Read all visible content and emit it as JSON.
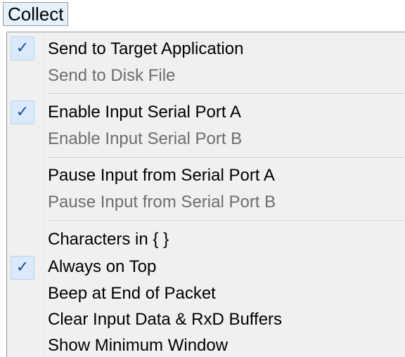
{
  "menu": {
    "title": "Collect",
    "items": [
      {
        "label": "Send to Target Application",
        "checked": true,
        "enabled": true
      },
      {
        "label": "Send to Disk File",
        "checked": false,
        "enabled": false
      },
      {
        "label": "Enable Input Serial Port A",
        "checked": true,
        "enabled": true
      },
      {
        "label": "Enable Input Serial Port B",
        "checked": false,
        "enabled": false
      },
      {
        "label": "Pause Input from Serial Port A",
        "checked": false,
        "enabled": true
      },
      {
        "label": "Pause Input from Serial Port B",
        "checked": false,
        "enabled": false
      },
      {
        "label": "Characters in { }",
        "checked": false,
        "enabled": true
      },
      {
        "label": "Always on Top",
        "checked": true,
        "enabled": true
      },
      {
        "label": "Beep at End of Packet",
        "checked": false,
        "enabled": true
      },
      {
        "label": "Clear Input Data & RxD Buffers",
        "checked": false,
        "enabled": true
      },
      {
        "label": "Show Minimum Window",
        "checked": false,
        "enabled": true
      }
    ],
    "check_glyph": "✓",
    "icons": {
      "check": "checkmark-icon"
    }
  },
  "colors": {
    "panel_bg": "#f0f0f0",
    "check_bg": "#dbeafb",
    "check_border": "#b7d4ef",
    "check_mark": "#1a4f9c",
    "disabled_text": "#6d6d6d"
  }
}
